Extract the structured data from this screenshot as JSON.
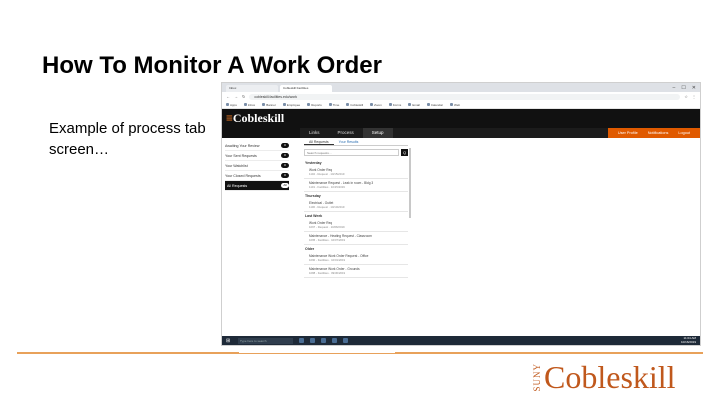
{
  "slide": {
    "title": "How To Monitor A Work Order",
    "body": "Example of process tab screen…",
    "logo_suny": "SUNY",
    "logo_word": "Cobleskill"
  },
  "colors": {
    "accent": "#e05a00",
    "rule": "#e8a15a",
    "logo": "#c0581c",
    "app_dark": "#111111"
  },
  "browser": {
    "tabs": [
      {
        "label": "Inbox",
        "active": false
      },
      {
        "label": "Cobleskill Facilities",
        "active": true
      }
    ],
    "window_controls": [
      "–",
      "☐",
      "✕"
    ],
    "address": "cobleskill.facilities.edu/work",
    "bookmarks": [
      "Apps",
      "Inbox",
      "Banner",
      "Employee",
      "Reports",
      "Time",
      "Cobleskill",
      "Zoom",
      "Forms",
      "Email",
      "Calendar",
      "Web"
    ]
  },
  "app": {
    "logo_prefix": "≡",
    "logo_word": "Cobleskill",
    "nav": [
      {
        "label": "Links",
        "active": false
      },
      {
        "label": "Process",
        "active": true
      },
      {
        "label": "Setup",
        "active": false
      }
    ],
    "nav_right": [
      "User Profile",
      "Notifications",
      "Logout"
    ],
    "sidebar": [
      {
        "label": "Awaiting Your Review",
        "count": "0",
        "selected": false
      },
      {
        "label": "Your Sent Requests",
        "count": "0",
        "selected": false
      },
      {
        "label": "Your Watchlist",
        "count": "0",
        "selected": false
      },
      {
        "label": "Your Closed Requests",
        "count": "0",
        "selected": false
      },
      {
        "label": "All Requests",
        "count": "All",
        "selected": true
      }
    ],
    "main_tabs": [
      {
        "label": "All Requests",
        "active": true
      },
      {
        "label": "Your Results",
        "active": false
      }
    ],
    "search_placeholder": "Search requests…",
    "search_button": "Q",
    "groups": [
      {
        "heading": "Yesterday",
        "items": [
          {
            "title": "Work Order Req",
            "meta": "1102 - Request · 10/15/2019"
          },
          {
            "title": "Maintenance Request - Leak in room - Bldg 3",
            "meta": "1101 - Facilities · 10/15/2019"
          }
        ]
      },
      {
        "heading": "Thursday",
        "items": [
          {
            "title": "Electrical - Outlet",
            "meta": "1100 - Request · 10/10/2019"
          }
        ]
      },
      {
        "heading": "Last Week",
        "items": [
          {
            "title": "Work Order Req",
            "meta": "1097 - Request · 10/08/2019"
          },
          {
            "title": "Maintenance - Heating Request - Classroom",
            "meta": "1095 - Facilities · 10/07/2019"
          }
        ]
      },
      {
        "heading": "Older",
        "items": [
          {
            "title": "Maintenance Work Order Request - Office",
            "meta": "1090 - Facilities · 10/01/2019"
          },
          {
            "title": "Maintenance Work Order - Grounds",
            "meta": "1088 - Facilities · 09/30/2019"
          }
        ]
      }
    ]
  },
  "taskbar": {
    "start": "⊞",
    "search": "Type here to search",
    "clock_time": "11:04 AM",
    "clock_date": "10/16/2019"
  }
}
